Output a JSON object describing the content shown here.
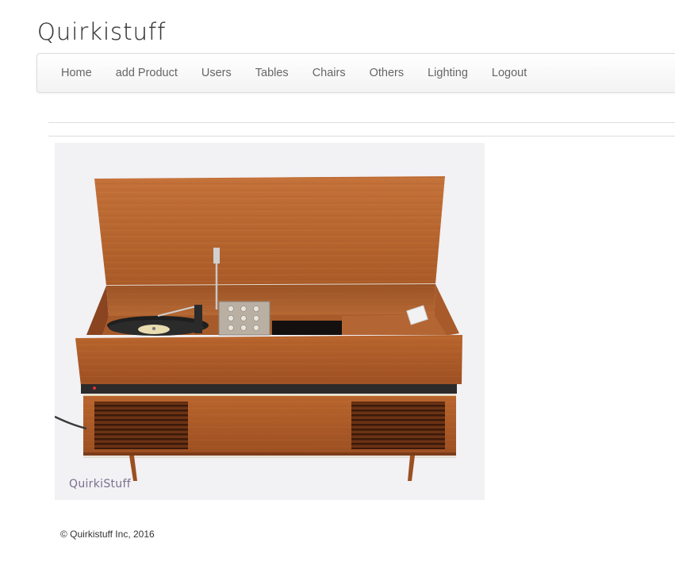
{
  "brand": {
    "title": "Quirkistuff"
  },
  "nav": {
    "items": [
      {
        "label": "Home"
      },
      {
        "label": "add Product"
      },
      {
        "label": "Users"
      },
      {
        "label": "Tables"
      },
      {
        "label": "Chairs"
      },
      {
        "label": "Others"
      },
      {
        "label": "Lighting"
      },
      {
        "label": "Logout"
      }
    ]
  },
  "product": {
    "image_watermark": "QuirkiStuff"
  },
  "footer": {
    "copyright": "© Quirkistuff Inc, 2016"
  },
  "colors": {
    "wood": "#b5652e",
    "wood_dark": "#8a4520",
    "background": "#f2f1f4"
  }
}
